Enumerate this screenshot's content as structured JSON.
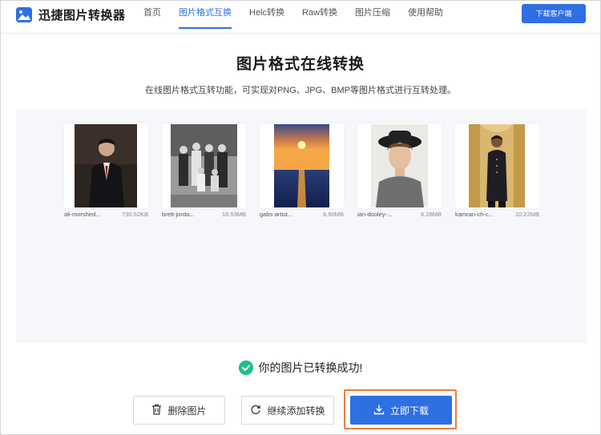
{
  "brand": {
    "name": "迅捷图片转换器"
  },
  "nav": {
    "links": [
      {
        "label": "首页",
        "active": false
      },
      {
        "label": "图片格式互换",
        "active": true
      },
      {
        "label": "Helc转换",
        "active": false
      },
      {
        "label": "Raw转换",
        "active": false
      },
      {
        "label": "图片压缩",
        "active": false
      },
      {
        "label": "使用帮助",
        "active": false
      }
    ],
    "cta_label": "下载客户端"
  },
  "hero": {
    "title": "图片格式在线转换",
    "subtitle": "在线图片格式互转功能，可实现对PNG、JPG、BMP等图片格式进行互转处理。"
  },
  "files": [
    {
      "name": "ali-morshed...",
      "size": "730.52KB",
      "icon": "portrait-suit-photo"
    },
    {
      "name": "brett-jorda...",
      "size": "18.53MB",
      "icon": "vintage-family-photo"
    },
    {
      "name": "gabs-artist...",
      "size": "6.90MB",
      "icon": "sunset-sea-photo"
    },
    {
      "name": "ian-dooley-...",
      "size": "6.28MB",
      "icon": "portrait-hat-photo"
    },
    {
      "name": "kamran-ch-c...",
      "size": "10.22MB",
      "icon": "portrait-ornate-photo"
    }
  ],
  "status": {
    "text": "你的图片已转换成功!",
    "icon": "check-circle-icon",
    "color": "#1fbf8a"
  },
  "actions": {
    "delete_label": "删除图片",
    "continue_label": "继续添加转换",
    "download_label": "立即下载"
  },
  "colors": {
    "accent": "#2f6fe4",
    "highlight_border": "#f07a3c",
    "panel_bg": "#f5f7fa"
  }
}
